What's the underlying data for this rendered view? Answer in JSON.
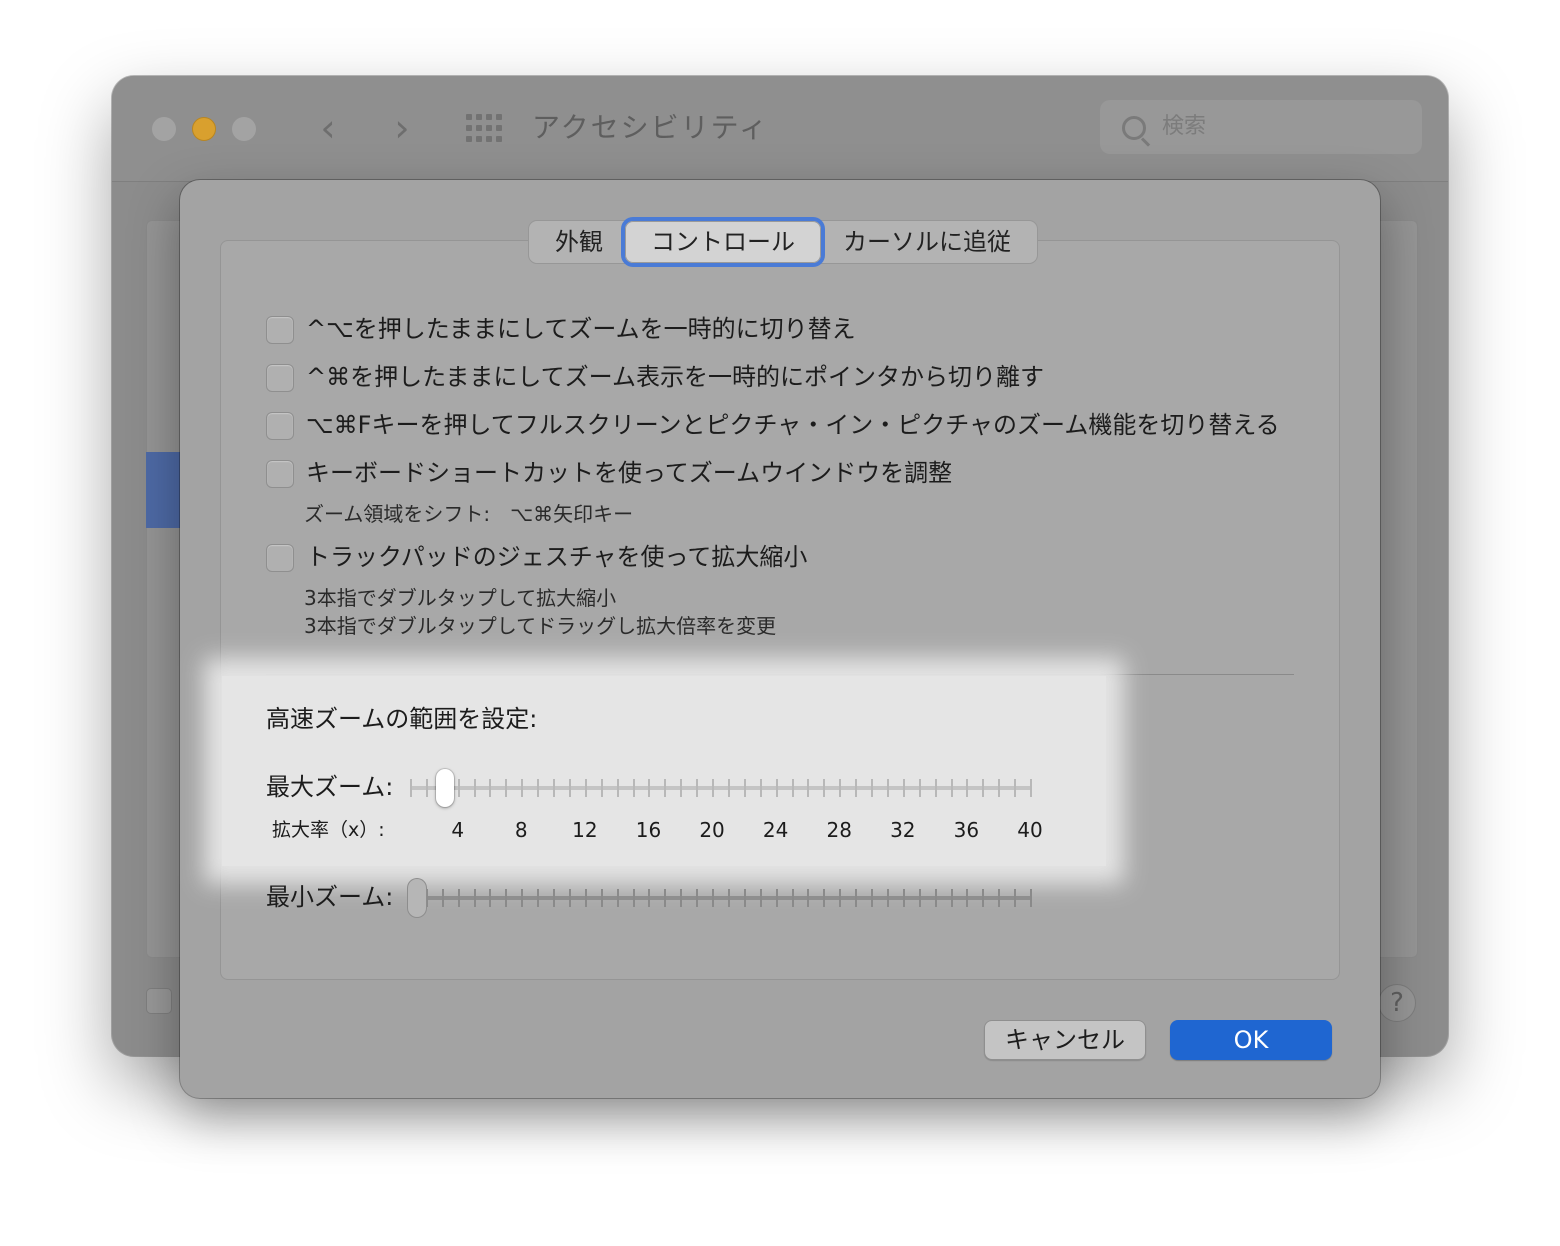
{
  "window": {
    "title": "アクセシビリティ",
    "search_placeholder": "検索",
    "back_icon": "‹",
    "forward_icon": "›",
    "help_label": "?"
  },
  "tabs": [
    {
      "label": "外観",
      "selected": false
    },
    {
      "label": "コントロール",
      "selected": true
    },
    {
      "label": "カーソルに追従",
      "selected": false
    }
  ],
  "options": [
    {
      "label": "^⌥を押したままにしてズームを一時的に切り替え",
      "checked": false
    },
    {
      "label": "^⌘を押したままにしてズーム表示を一時的にポインタから切り離す",
      "checked": false
    },
    {
      "label": "⌥⌘Fキーを押してフルスクリーンとピクチャ・イン・ピクチャのズーム機能を切り替える",
      "checked": false
    },
    {
      "label": "キーボードショートカットを使ってズームウインドウを調整",
      "checked": false,
      "subtext": [
        "ズーム領域をシフト:　⌥⌘矢印キー"
      ]
    },
    {
      "label": "トラックパッドのジェスチャを使って拡大縮小",
      "checked": false,
      "subtext": [
        "3本指でダブルタップして拡大縮小",
        "3本指でダブルタップしてドラッグし拡大倍率を変更"
      ]
    }
  ],
  "zoom_range": {
    "title": "高速ズームの範囲を設定:",
    "max_label": "最大ズーム:",
    "min_label": "最小ズーム:",
    "scale_label": "拡大率（x）:",
    "scale_values": [
      "4",
      "8",
      "12",
      "16",
      "20",
      "24",
      "28",
      "32",
      "36",
      "40"
    ],
    "max_value_fraction": 0.04,
    "min_value_fraction": 0.0
  },
  "buttons": {
    "cancel": "キャンセル",
    "ok": "OK"
  },
  "colors": {
    "accent": "#1f66d1",
    "tab_focus": "#4a7bd6",
    "minimize": "#d9a02e"
  }
}
